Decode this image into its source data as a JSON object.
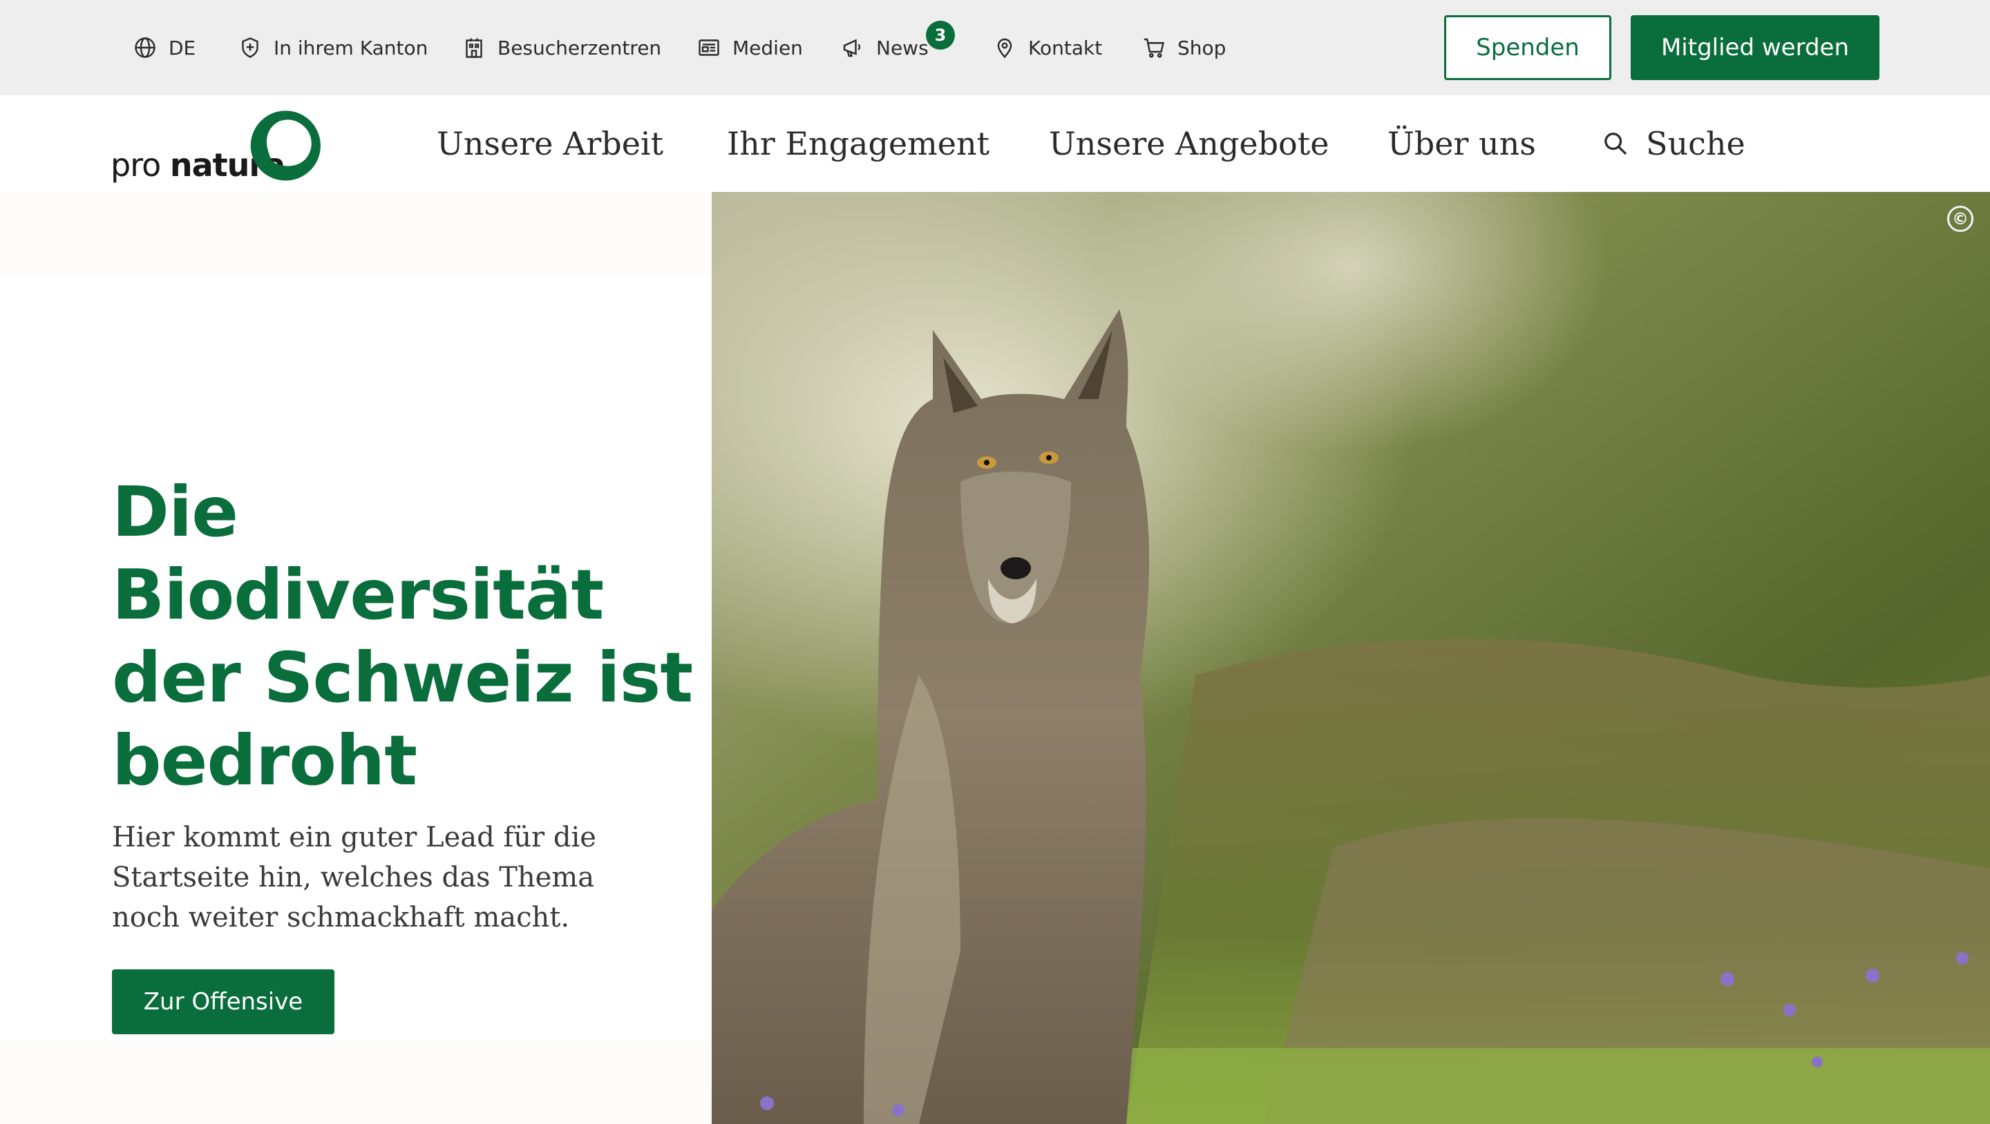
{
  "topbar": {
    "language": "DE",
    "canton": "In ihrem Kanton",
    "visitor_centers": "Besucherzentren",
    "media": "Medien",
    "news": "News",
    "news_count": "3",
    "contact": "Kontakt",
    "shop": "Shop",
    "donate_label": "Spenden",
    "member_label": "Mitglied werden"
  },
  "logo": {
    "pro": "pro",
    "natura": "natura"
  },
  "nav": {
    "items": [
      "Unsere Arbeit",
      "Ihr Engagement",
      "Unsere Angebote",
      "Über uns"
    ],
    "search": "Suche"
  },
  "hero": {
    "headline_lines": [
      "Die",
      "Biodiversität",
      "der Schweiz ist",
      "bedroht"
    ],
    "lead": "Hier kommt ein guter Lead für die Startseite hin, welches das Thema noch weiter schmackhaft macht.",
    "cta": "Zur Offensive",
    "copyright_symbol": "©"
  },
  "colors": {
    "brand_green": "#0a6e3c",
    "topbar_bg": "#efeeee"
  },
  "icons": [
    "globe-icon",
    "shield-icon",
    "building-icon",
    "newspaper-icon",
    "megaphone-icon",
    "location-pin-icon",
    "cart-icon",
    "search-icon",
    "ibex-logo-icon",
    "copyright-icon"
  ]
}
